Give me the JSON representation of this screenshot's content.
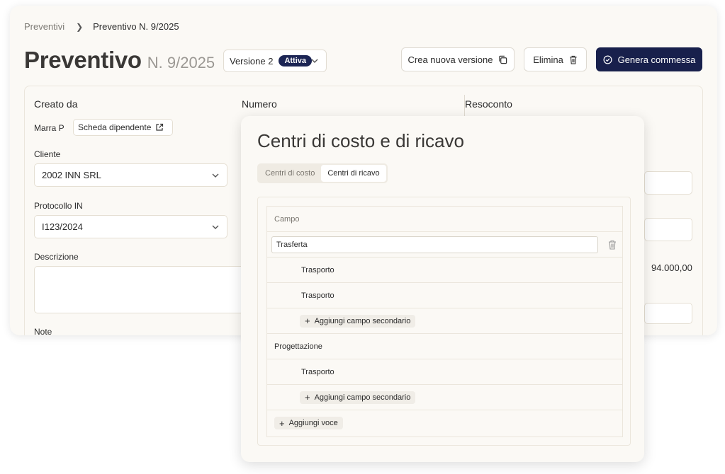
{
  "breadcrumb": {
    "parent": "Preventivi",
    "current": "Preventivo N. 9/2025"
  },
  "header": {
    "title": "Preventivo",
    "number": "N. 9/2025"
  },
  "version": {
    "label": "Versione 2",
    "badge": "Attiva"
  },
  "actions": {
    "new_version": "Crea nuova versione",
    "delete": "Elimina",
    "generate": "Genera commessa"
  },
  "form": {
    "created_by_label": "Creato da",
    "created_by_value": "Marra P",
    "employee_card_label": "Scheda dipendente",
    "number_label": "Numero",
    "client_label": "Cliente",
    "client_value": "2002 INN SRL",
    "protocol_label": "Protocollo IN",
    "protocol_value": "I123/2024",
    "description_label": "Descrizione",
    "notes_label": "Note"
  },
  "summary": {
    "label": "Resoconto",
    "amount": "94.000,00"
  },
  "modal": {
    "title": "Centri di costo e di ricavo",
    "tabs": [
      {
        "label": "Centri di costo",
        "active": false
      },
      {
        "label": "Centri di ricavo",
        "active": true
      }
    ],
    "table_header": "Campo",
    "groups": [
      {
        "name": "Trasferta",
        "children": [
          "Trasporto",
          "Trasporto"
        ],
        "add_label": "Aggiungi campo secondario"
      },
      {
        "name": "Progettazione",
        "children": [
          "Trasporto"
        ],
        "add_label": "Aggiungi campo secondario"
      }
    ],
    "add_item_label": "Aggiungi voce"
  },
  "colors": {
    "accent": "#18204c",
    "background": "#fbf9f5",
    "border": "#e5dfd3"
  }
}
